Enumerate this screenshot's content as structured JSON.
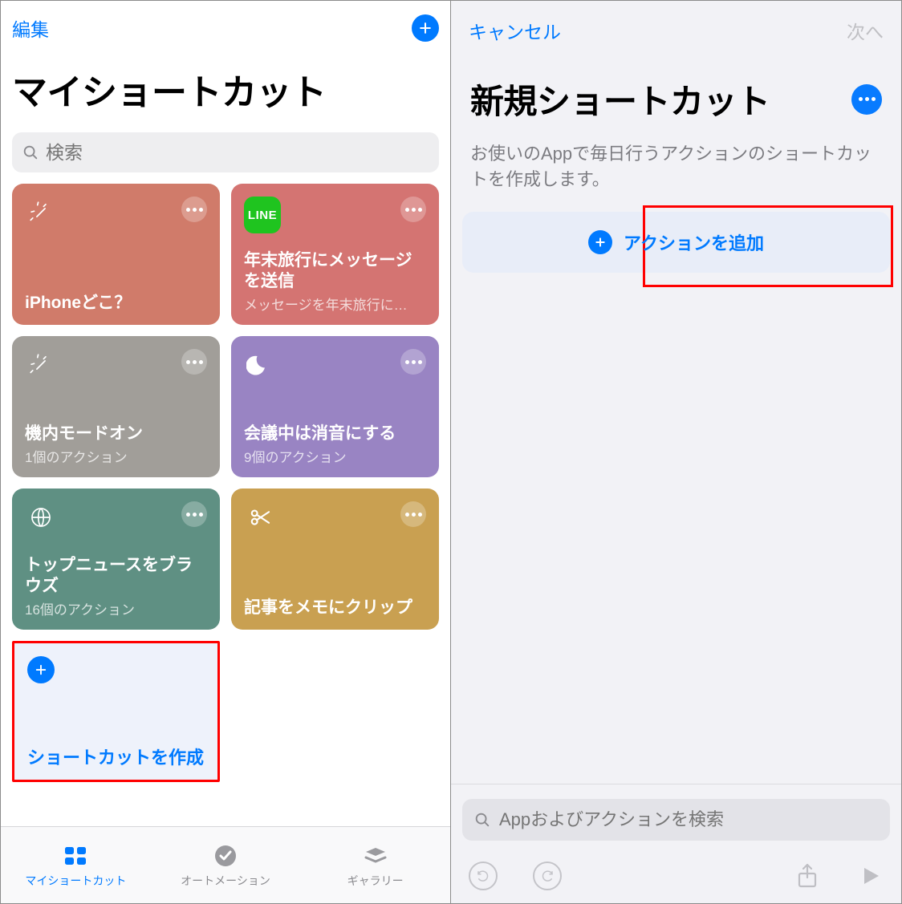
{
  "left": {
    "edit": "編集",
    "title": "マイショートカット",
    "search_placeholder": "検索",
    "tiles": [
      {
        "title": "iPhoneどこ？",
        "sub": ""
      },
      {
        "title": "年末旅行にメッセージを送信",
        "sub": "メッセージを年末旅行に…"
      },
      {
        "title": "機内モードオン",
        "sub": "1個のアクション"
      },
      {
        "title": "会議中は消音にする",
        "sub": "9個のアクション"
      },
      {
        "title": "トップニュースをブラウズ",
        "sub": "16個のアクション"
      },
      {
        "title": "記事をメモにクリップ",
        "sub": ""
      }
    ],
    "create_label": "ショートカットを作成",
    "tabs": {
      "my": "マイショートカット",
      "automation": "オートメーション",
      "gallery": "ギャラリー"
    }
  },
  "right": {
    "cancel": "キャンセル",
    "next": "次へ",
    "title": "新規ショートカット",
    "desc": "お使いのAppで毎日行うアクションのショートカットを作成します。",
    "add_action": "アクションを追加",
    "appsearch_placeholder": "Appおよびアクションを検索"
  },
  "icons": {
    "line": "LINE"
  }
}
